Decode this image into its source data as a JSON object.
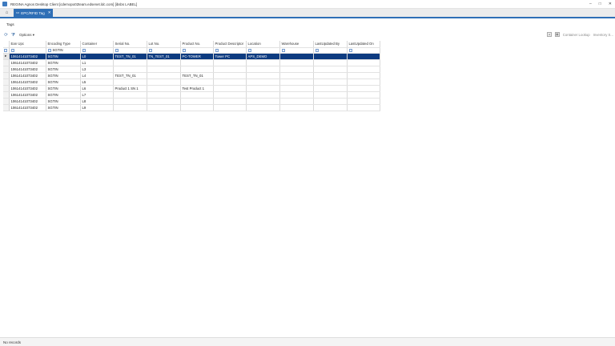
{
  "window": {
    "title": "REGINA Agnos Desktop Client [cdemopo02team.edsenet.ldc.com] [ibsbs LABEL]",
    "controls": [
      "–",
      "□",
      "✕"
    ]
  },
  "tabs": [
    {
      "label": "EPC/RFID Tag",
      "active": true
    }
  ],
  "section_label": "Tags",
  "toolbar": {
    "options_label": "Options ▾",
    "right_buttons": [
      "Container Lookup",
      "Inventory S..."
    ]
  },
  "grid": {
    "columns": [
      "Ean Upc",
      "Encoding Type",
      "Container",
      "Serial No.",
      "Lot No.",
      "Product No.",
      "Product Descriptor",
      "Location",
      "Warehouse",
      "LastUpdated By",
      "LastUpdated On"
    ],
    "filter_values": [
      "",
      "SGTIN",
      "",
      "",
      "",
      "",
      "",
      "",
      "",
      "",
      ""
    ],
    "rows": [
      [
        "10614141073402",
        "SGTIN",
        "L0",
        "TEST_TN_01",
        "TN_TEST_01",
        "PC-TOWER",
        "Tower PC",
        "APS_DEMO",
        "",
        "",
        ""
      ],
      [
        "10614141073402",
        "SGTIN",
        "L1",
        "",
        "",
        "",
        "",
        "",
        "",
        "",
        ""
      ],
      [
        "10614141073402",
        "SGTIN",
        "L3",
        "",
        "",
        "",
        "",
        "",
        "",
        "",
        ""
      ],
      [
        "10614141073402",
        "SGTIN",
        "L4",
        "TEST_TN_01",
        "",
        "TEST_TN_01",
        "",
        "",
        "",
        "",
        ""
      ],
      [
        "10614141073402",
        "SGTIN",
        "L5",
        "",
        "",
        "",
        "",
        "",
        "",
        "",
        ""
      ],
      [
        "10614141073402",
        "SGTIN",
        "L6",
        "Product 1 SN 1",
        "",
        "Test Product 1",
        "",
        "",
        "",
        "",
        ""
      ],
      [
        "10614141073402",
        "SGTIN",
        "L7",
        "",
        "",
        "",
        "",
        "",
        "",
        "",
        ""
      ],
      [
        "10614141073402",
        "SGTIN",
        "L8",
        "",
        "",
        "",
        "",
        "",
        "",
        "",
        ""
      ],
      [
        "10614141073402",
        "SGTIN",
        "L9",
        "",
        "",
        "",
        "",
        "",
        "",
        "",
        ""
      ]
    ],
    "selected_row": 0
  },
  "status": {
    "text": "No records"
  },
  "colors": {
    "accent": "#2f6fb6",
    "selected_row": "#0d3b80"
  }
}
